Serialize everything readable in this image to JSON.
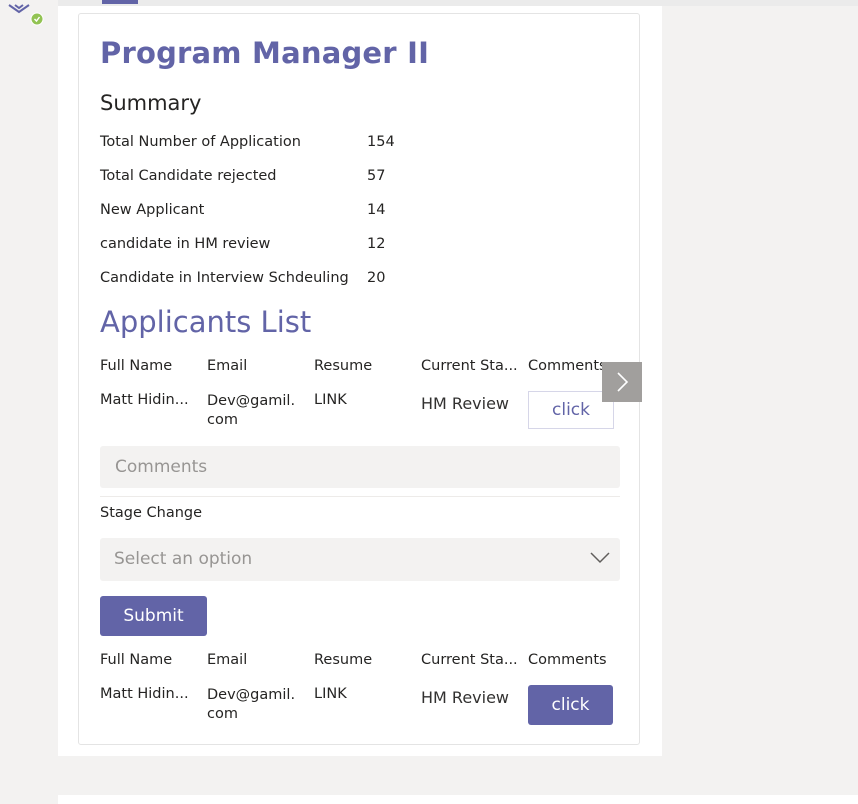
{
  "title": "Program Manager II",
  "summary": {
    "heading": "Summary",
    "rows": [
      {
        "label": "Total Number of Application",
        "value": "154"
      },
      {
        "label": "Total Candidate rejected",
        "value": "57"
      },
      {
        "label": "New Applicant",
        "value": "14"
      },
      {
        "label": "candidate in HM review",
        "value": "12"
      },
      {
        "label": "Candidate in Interview Schdeuling",
        "value": "20"
      }
    ]
  },
  "applicants": {
    "heading": "Applicants List",
    "columns": [
      "Full Name",
      "Email",
      "Resume",
      "Current Sta...",
      "Comments"
    ],
    "rows": [
      {
        "name": "Matt Hidin...",
        "email": "Dev@gamil.com",
        "resume": "LINK",
        "status": "HM Review",
        "action": "click"
      },
      {
        "name": "Matt Hidin...",
        "email": "Dev@gamil.com",
        "resume": "LINK",
        "status": "HM Review",
        "action": "click"
      }
    ]
  },
  "form": {
    "comments_placeholder": "Comments",
    "comments_value": "",
    "stage_label": "Stage Change",
    "stage_placeholder": "Select an option",
    "submit_label": "Submit"
  },
  "icons": {
    "avatar": "avatar-icon",
    "status": "status-check-icon",
    "scroll": "chevron-right-icon",
    "dropdown": "chevron-down-icon"
  },
  "colors": {
    "accent": "#6264a7",
    "status_online": "#92c353",
    "background": "#f3f2f1"
  }
}
